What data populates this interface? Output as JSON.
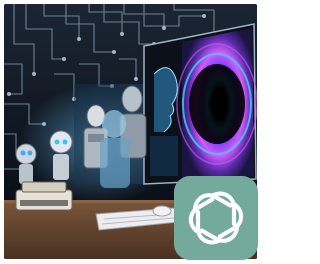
{
  "image": {
    "description_tag": "ai-evolution-illustration",
    "accent_colors": {
      "background_dark": "#0f1620",
      "circuit_light": "#8aa3b8",
      "vortex_purple": "#b04dff",
      "vortex_cyan": "#3fd4ff",
      "desk_wood": "#6b4a32",
      "logo_tile": "#74aa9c",
      "logo_mark": "#ffffff"
    },
    "elements": {
      "circuit_wall": "circuit-board-pattern",
      "robots": [
        "small-round-robot",
        "small-round-robot-2",
        "humanoid-robot",
        "android-head",
        "translucent-humanoid"
      ],
      "monitor": "monitor-with-portal",
      "desk_items": [
        "typewriter",
        "keyboard",
        "mouse"
      ],
      "logo": "openai-knot-logo"
    }
  }
}
